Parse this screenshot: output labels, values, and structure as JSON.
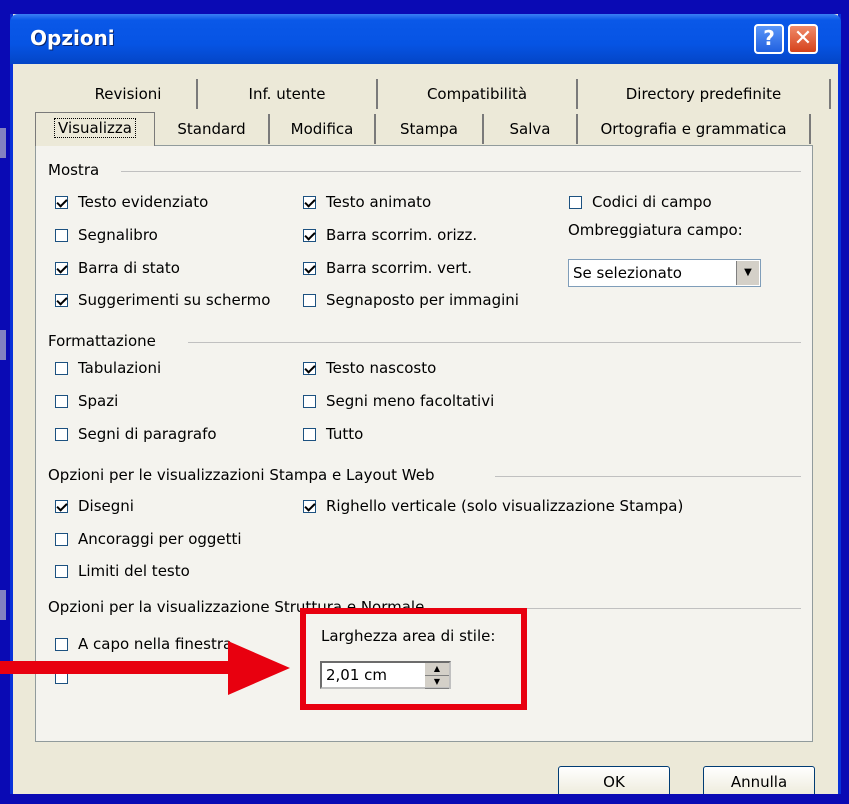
{
  "window": {
    "title": "Opzioni"
  },
  "tabs": {
    "row1": [
      "Revisioni",
      "Inf. utente",
      "Compatibilità",
      "Directory predefinite"
    ],
    "row2": [
      "Visualizza",
      "Standard",
      "Modifica",
      "Stampa",
      "Salva",
      "Ortografia e grammatica"
    ]
  },
  "mostra": {
    "heading": "Mostra",
    "testo_evidenziato": "Testo evidenziato",
    "segnalibro": "Segnalibro",
    "barra_stato": "Barra di stato",
    "suggerimenti": "Suggerimenti su schermo",
    "testo_animato": "Testo animato",
    "barra_orizz": "Barra scorrim. orizz.",
    "barra_vert": "Barra scorrim. vert.",
    "segnaposto": "Segnaposto per immagini",
    "codici_campo": "Codici di campo",
    "ombreggiatura_label": "Ombreggiatura campo:",
    "ombreggiatura_value": "Se selezionato"
  },
  "formattazione": {
    "heading": "Formattazione",
    "tabulazioni": "Tabulazioni",
    "spazi": "Spazi",
    "segni_paragrafo": "Segni di paragrafo",
    "testo_nascosto": "Testo nascosto",
    "segni_meno": "Segni meno facoltativi",
    "tutto": "Tutto"
  },
  "stampa_web": {
    "heading": "Opzioni per le visualizzazioni Stampa e Layout Web",
    "disegni": "Disegni",
    "ancoraggi": "Ancoraggi per oggetti",
    "limiti": "Limiti del testo",
    "righello": "Righello verticale (solo visualizzazione Stampa)"
  },
  "struttura": {
    "heading": "Opzioni per la visualizzazione Struttura e Normale",
    "a_capo": "A capo nella finestra",
    "larghezza_label": "Larghezza area di stile:",
    "larghezza_value": "2,01 cm"
  },
  "buttons": {
    "ok": "OK",
    "annulla": "Annulla"
  },
  "colors": {
    "highlight": "#e8000f",
    "titlebar": "#0654e4",
    "background": "#0a0ab4"
  }
}
